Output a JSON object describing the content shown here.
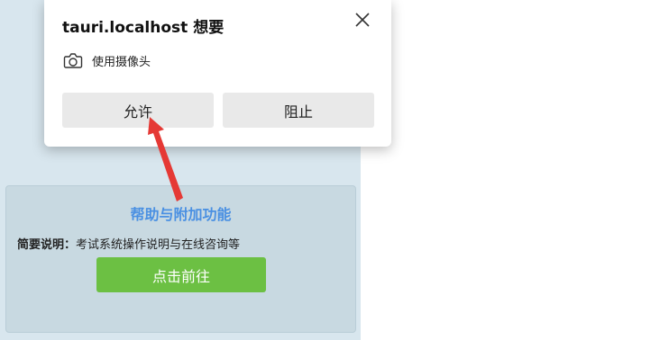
{
  "dialog": {
    "title": "tauri.localhost 想要",
    "permission": "使用摄像头",
    "allow_label": "允许",
    "block_label": "阻止"
  },
  "feature": {
    "title": "帮助与附加功能",
    "desc_label": "简要说明：",
    "desc_text": "考试系统操作说明与在线咨询等",
    "button_label": "点击前往"
  },
  "colors": {
    "accent_blue": "#4a90e2",
    "go_green": "#6cc043",
    "annotation_red": "#e53935"
  },
  "icons": {
    "close": "close-icon",
    "camera": "camera-icon"
  }
}
